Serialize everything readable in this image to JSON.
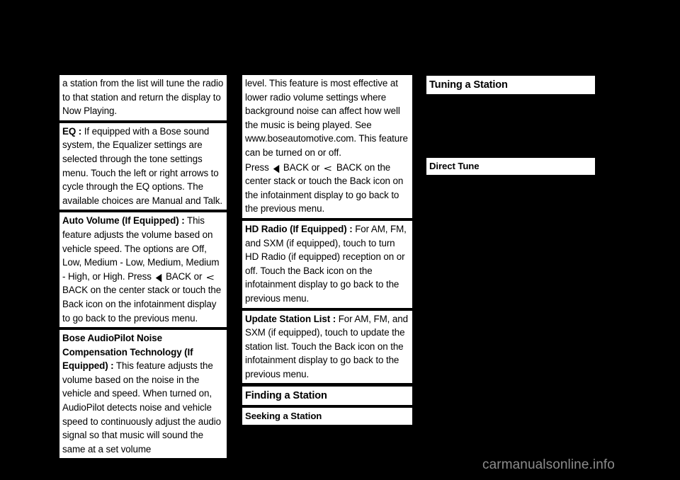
{
  "page": {
    "background_color": "#000000",
    "text_color": "#000000",
    "paper_color": "#ffffff",
    "watermark": "carmanualsonline.info",
    "watermark_color": "#8c8c8c"
  },
  "icons": {
    "back_triangle": "◀",
    "back_chevron": "<"
  },
  "left_column": {
    "continued_paragraph": {
      "text": "a station from the list will tune the radio to that station and return the display to Now Playing."
    },
    "eq": {
      "term": "EQ :",
      "body": " If equipped with a Bose sound system, the Equalizer settings are selected through the tone settings menu. Touch the left or right arrows to cycle through the EQ options. The available choices are Manual and Talk."
    },
    "auto_volume": {
      "term": "Auto Volume (If Equipped) :",
      "body_part1": " This feature adjusts the volume based on vehicle speed. The options are Off, Low, Medium - Low, Medium, Medium - High, or High. Press ",
      "body_part2": " BACK or ",
      "body_part3": " BACK on the center stack or touch the Back icon on the infotainment display to go back to the previous menu."
    },
    "bose_audiopilot": {
      "term": "Bose AudioPilot Noise Compensation Technology (If Equipped) :",
      "body": " This feature adjusts the volume based on the noise in the vehicle and speed. When turned on, AudioPilot detects noise and vehicle speed to continuously adjust the audio signal so that music will sound the same at a set volume"
    }
  },
  "middle_column": {
    "bose_continued": {
      "paragraph1": "level. This feature is most effective at lower radio volume settings where background noise can affect how well the music is being played. See www.boseautomotive.com. This feature can be turned on or off.",
      "paragraph2_part1": "Press ",
      "paragraph2_part2": " BACK or ",
      "paragraph2_part3": " BACK on the center stack or touch the Back icon on the infotainment display to go back to the previous menu."
    },
    "hd_radio": {
      "term": "HD Radio (If Equipped) :",
      "body": " For AM, FM, and SXM (if equipped), touch to turn HD Radio (if equipped) reception on or off. Touch the Back icon on the infotainment display to go back to the previous menu."
    },
    "update_station_list": {
      "term": "Update Station List :",
      "body": " For AM, FM, and SXM (if equipped), touch to update the station list. Touch the Back icon on the infotainment display to go back to the previous menu."
    },
    "heading_finding_a_station": "Finding a Station",
    "heading_seeking_a_station": "Seeking a Station"
  },
  "right_column": {
    "heading_tuning_a_station": "Tuning a Station",
    "heading_direct_tune": "Direct Tune"
  }
}
